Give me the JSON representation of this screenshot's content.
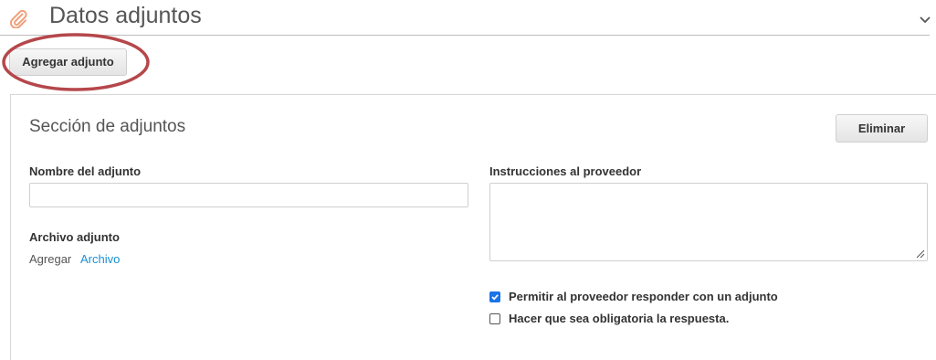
{
  "header": {
    "title": "Datos adjuntos"
  },
  "toolbar": {
    "add_label": "Agregar adjunto"
  },
  "section": {
    "title": "Sección de adjuntos",
    "delete_label": "Eliminar",
    "name_label": "Nombre del adjunto",
    "name_value": "",
    "instructions_label": "Instrucciones al proveedor",
    "instructions_value": "",
    "file_label": "Archivo adjunto",
    "add_prefix": "Agregar",
    "file_link": "Archivo",
    "options": [
      {
        "label": "Permitir al proveedor responder con un adjunto",
        "checked": true
      },
      {
        "label": "Hacer que sea obligatoria la respuesta.",
        "checked": false
      }
    ]
  },
  "colors": {
    "accent": "#1a73e8",
    "link": "#1a8fd6",
    "highlight": "#b5474b",
    "paperclip": "#f0a07a"
  },
  "icons": {
    "paperclip": "paperclip-icon",
    "chevron": "chevron-down-icon",
    "resize": "resize-grip-icon",
    "check": "check-icon"
  }
}
